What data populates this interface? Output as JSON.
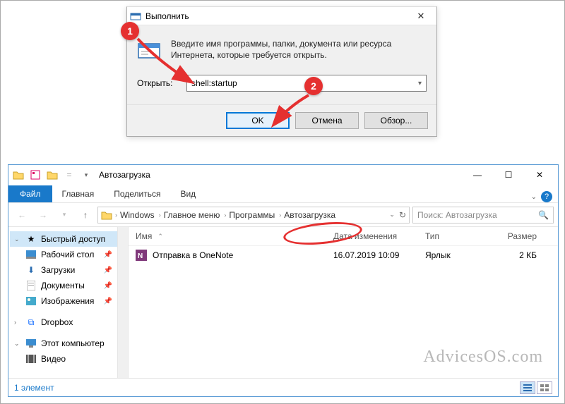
{
  "run": {
    "title": "Выполнить",
    "desc": "Введите имя программы, папки, документа или ресурса Интернета, которые требуется открыть.",
    "open_label": "Открыть:",
    "input_value": "shell:startup",
    "ok": "OK",
    "cancel": "Отмена",
    "browse": "Обзор..."
  },
  "explorer": {
    "title": "Автозагрузка",
    "tabs": {
      "file": "Файл",
      "home": "Главная",
      "share": "Поделиться",
      "view": "Вид"
    },
    "crumbs": [
      "Windows",
      "Главное меню",
      "Программы",
      "Автозагрузка"
    ],
    "search_placeholder": "Поиск: Автозагрузка",
    "columns": {
      "name": "Имя",
      "date": "Дата изменения",
      "type": "Тип",
      "size": "Размер"
    },
    "nav": {
      "quick": "Быстрый доступ",
      "desktop": "Рабочий стол",
      "downloads": "Загрузки",
      "documents": "Документы",
      "pictures": "Изображения",
      "dropbox": "Dropbox",
      "thispc": "Этот компьютер",
      "videos": "Видео"
    },
    "rows": [
      {
        "name": "Отправка в OneNote",
        "date": "16.07.2019 10:09",
        "type": "Ярлык",
        "size": "2 КБ"
      }
    ],
    "status": "1 элемент"
  },
  "callouts": {
    "1": "1",
    "2": "2"
  },
  "watermark": "AdvicesOS.com"
}
